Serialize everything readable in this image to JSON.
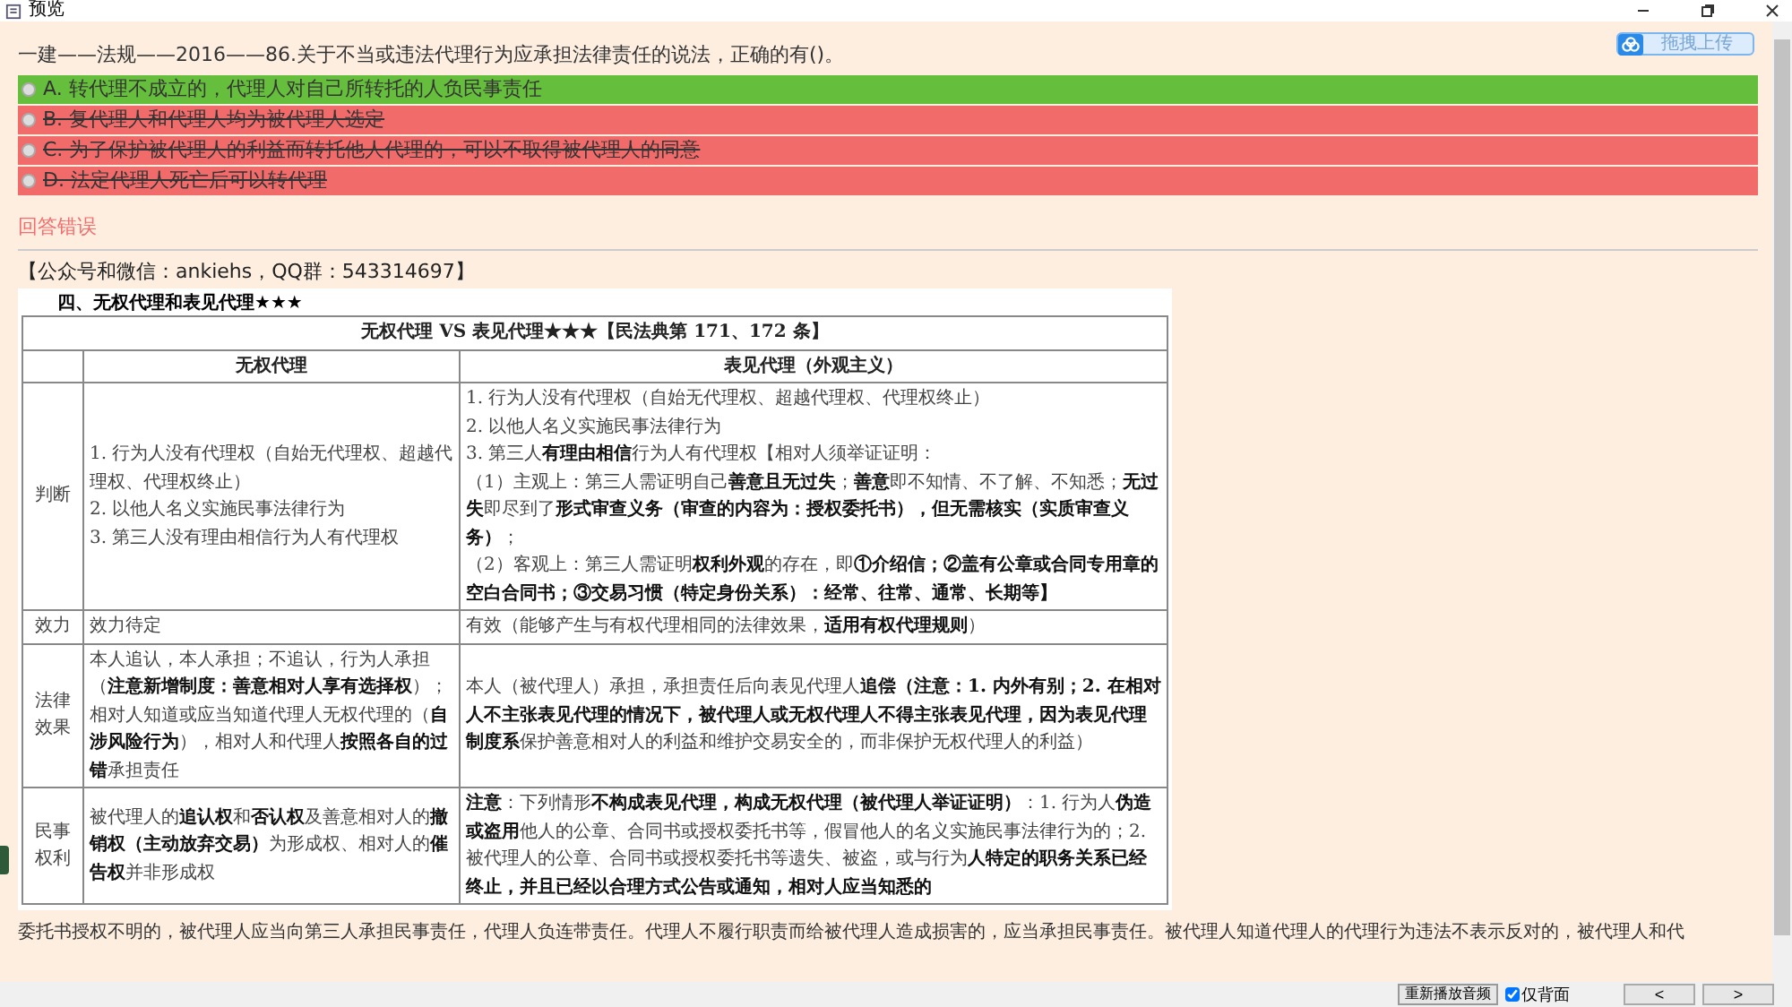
{
  "window": {
    "title": "预览"
  },
  "upload_button": {
    "label": "拖拽上传"
  },
  "question": "一建——法规——2016——86.关于不当或违法代理行为应承担法律责任的说法，正确的有()。",
  "options": [
    {
      "text": "A. 转代理不成立的，代理人对自己所转托的人负民事责任",
      "kind": "correct"
    },
    {
      "text": "B. 复代理人和代理人均为被代理人选定",
      "kind": "wrong"
    },
    {
      "text": "C. 为了保护被代理人的利益而转托他人代理的，可以不取得被代理人的同意",
      "kind": "wrong"
    },
    {
      "text": "D. 法定代理人死亡后可以转代理",
      "kind": "wrong"
    }
  ],
  "result": "回答错误",
  "source": "【公众号和微信：ankiehs，QQ群：543314697】",
  "document": {
    "heading": "四、无权代理和表见代理★★★",
    "caption": "无权代理 VS 表见代理★★★【民法典第 171、172 条】",
    "columns": [
      "无权代理",
      "表见代理（外观主义）"
    ],
    "rows": [
      {
        "label": "判断",
        "left": [
          "1. 行为人没有代理权（自始无代理权、超越代理权、代理权终止）",
          "2. 以他人名义实施民事法律行为",
          "3. 第三人没有理由相信行为人有代理权"
        ],
        "right": [
          "1. 行为人没有代理权（自始无代理权、超越代理权、代理权终止）",
          "2. 以他人名义实施民事法律行为",
          "3. 第三人**有理由相信**行为人有代理权【相对人须举证证明：",
          "（1）主观上：第三人需证明自己**善意且无过失**；**善意**即不知情、不了解、不知悉；**无过失**即尽到了**形式审查义务（审查的内容为：授权委托书），但无需核实（实质审查义务）**；",
          "（2）客观上：第三人需证明**权利外观**的存在，即**①介绍信；②盖有公章或合同专用章的空白合同书；③交易习惯（特定身份关系）：经常、往常、通常、长期等】**"
        ]
      },
      {
        "label": "效力",
        "left": [
          "效力待定"
        ],
        "right": [
          "有效（能够产生与有权代理相同的法律效果，**适用有权代理规则**）"
        ]
      },
      {
        "label": "法律效果",
        "left": [
          "本人追认，本人承担；不追认，行为人承担（**注意新增制度：善意相对人享有选择权**）；相对人知道或应当知道代理人无权代理的（**自涉风险行为**），相对人和代理人**按照各自的过错**承担责任"
        ],
        "right": [
          "本人（被代理人）承担，承担责任后向表见代理人**追偿（注意：1. 内外有别；2. 在相对人不主张表见代理的情况下，被代理人或无权代理人不得主张表见代理，因为表见代理制度系**保护善意相对人的利益和维护交易安全的，而非保护无权代理人的利益）"
        ]
      },
      {
        "label": "民事权利",
        "left": [
          "被代理人的**追认权**和**否认权**及善意相对人的**撤销权（主动放弃交易）**为形成权、相对人的**催告权**并非形成权"
        ],
        "right": [
          "**注意**：下列情形**不构成表见代理，构成无权代理（被代理人举证证明）**：1. 行为人**伪造或盗用**他人的公章、合同书或授权委托书等，假冒他人的名义实施民事法律行为的；2. 被代理人的公章、合同书或授权委托书等遗失、被盗，或与行为**人特定的职务关系已经终止，并且已经以合理方式公告或通知，相对人应当知悉的**"
        ]
      }
    ]
  },
  "explanation": "委托书授权不明的，被代理人应当向第三人承担民事责任，代理人负连带责任。代理人不履行职责而给被代理人造成损害的，应当承担民事责任。被代理人知道代理人的代理行为违法不表示反对的，被代理人和代",
  "bottom_bar": {
    "replay_button": "重新播放音频",
    "back_only": {
      "label": "仅背面",
      "checked": true
    },
    "prev": "<",
    "next": ">"
  }
}
